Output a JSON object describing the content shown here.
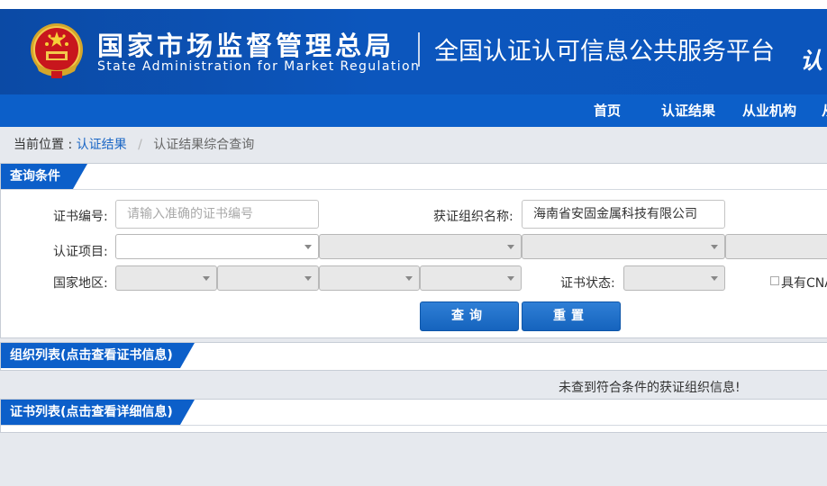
{
  "header": {
    "org_name_cn": "国家市场监督管理总局",
    "org_name_en": "State Administration  for  Market Regulation",
    "platform_title": "全国认证认可信息公共服务平台",
    "platform_title_partial": "认"
  },
  "nav": {
    "items": [
      "首页",
      "认证结果",
      "从业机构",
      "从"
    ]
  },
  "breadcrumb": {
    "prefix": "当前位置 :",
    "link": "认证结果",
    "separator": "/",
    "current": "认证结果综合查询"
  },
  "query_panel": {
    "title": "查询条件",
    "cert_no_label": "证书编号:",
    "cert_no_placeholder": "请输入准确的证书编号",
    "org_name_label": "获证组织名称:",
    "org_name_value": "海南省安固金属科技有限公司",
    "project_label": "认证项目:",
    "region_label": "国家地区:",
    "status_label": "证书状态:",
    "checkbox_label": "具有CNA",
    "search_button": "查询",
    "reset_button": "重置"
  },
  "org_list": {
    "title": "组织列表(点击查看证书信息)",
    "empty_message": "未查到符合条件的获证组织信息!"
  },
  "cert_list": {
    "title": "证书列表(点击查看详细信息)"
  },
  "colors": {
    "header_blue": "#0b55bc",
    "nav_blue": "#0c5fc9",
    "link_blue": "#1a66c5"
  }
}
